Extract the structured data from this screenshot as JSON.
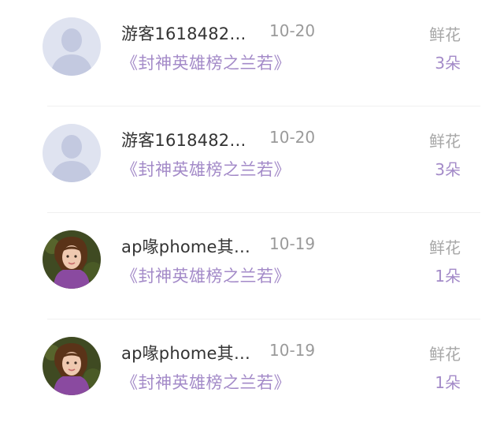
{
  "gift_records": [
    {
      "avatar": "default-user-icon",
      "username": "游客1618482…",
      "date": "10-20",
      "book": "《封神英雄榜之兰若》",
      "gift_type": "鲜花",
      "gift_count": "3朵"
    },
    {
      "avatar": "default-user-icon",
      "username": "游客1618482…",
      "date": "10-20",
      "book": "《封神英雄榜之兰若》",
      "gift_type": "鲜花",
      "gift_count": "3朵"
    },
    {
      "avatar": "user-photo",
      "username": "ap喙phome其…",
      "date": "10-19",
      "book": "《封神英雄榜之兰若》",
      "gift_type": "鲜花",
      "gift_count": "1朵"
    },
    {
      "avatar": "user-photo",
      "username": "ap喙phome其…",
      "date": "10-19",
      "book": "《封神英雄榜之兰若》",
      "gift_type": "鲜花",
      "gift_count": "1朵"
    }
  ],
  "colors": {
    "accent_purple": "#a38ac8",
    "default_avatar_bg": "#dfe3f0",
    "default_avatar_figure": "#c3c9e0"
  }
}
